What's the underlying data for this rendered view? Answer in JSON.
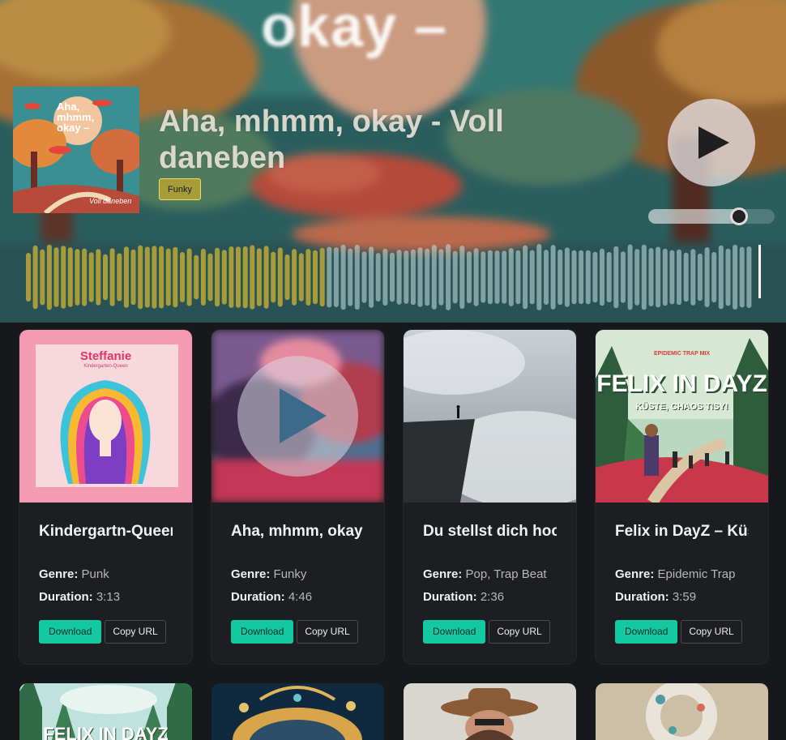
{
  "player": {
    "background_text": "okay –",
    "title": "Aha, mhmm, okay - Voll daneben",
    "genre": "Funky",
    "cover_text_lines": [
      "Aha,",
      "mhmm,",
      "okay –"
    ],
    "cover_caption": "Voll daneben",
    "volume_level": 0.75,
    "progress": 0.41,
    "accent_color": "#a69c3a"
  },
  "labels": {
    "genre": "Genre:",
    "duration": "Duration:",
    "download": "Download",
    "copy_url": "Copy URL"
  },
  "cards": [
    {
      "title": "Kindergartn-Queen",
      "genre": "Punk",
      "duration": "3:13",
      "cover_heading": "Steffanie",
      "cover_sub": "Kindergarten-Queen"
    },
    {
      "title": "Aha, mhmm, okay - Voll daneben",
      "genre": "Funky",
      "duration": "4:46"
    },
    {
      "title": "Du stellst dich hoch",
      "genre": "Pop, Trap Beat",
      "duration": "2:36"
    },
    {
      "title": "Felix in DayZ – Küste, Chaos Tisy!",
      "genre": "Epidemic Trap",
      "duration": "3:59",
      "cover_tag": "EPIDEMIC TRAP MIX",
      "cover_heading": "FELIX IN DAYZ",
      "cover_sub": "KÜSTE, CHAOS TISY!"
    }
  ],
  "next_row": [
    {
      "cover_heading": "FELIX IN DAYZ"
    },
    {},
    {},
    {}
  ]
}
